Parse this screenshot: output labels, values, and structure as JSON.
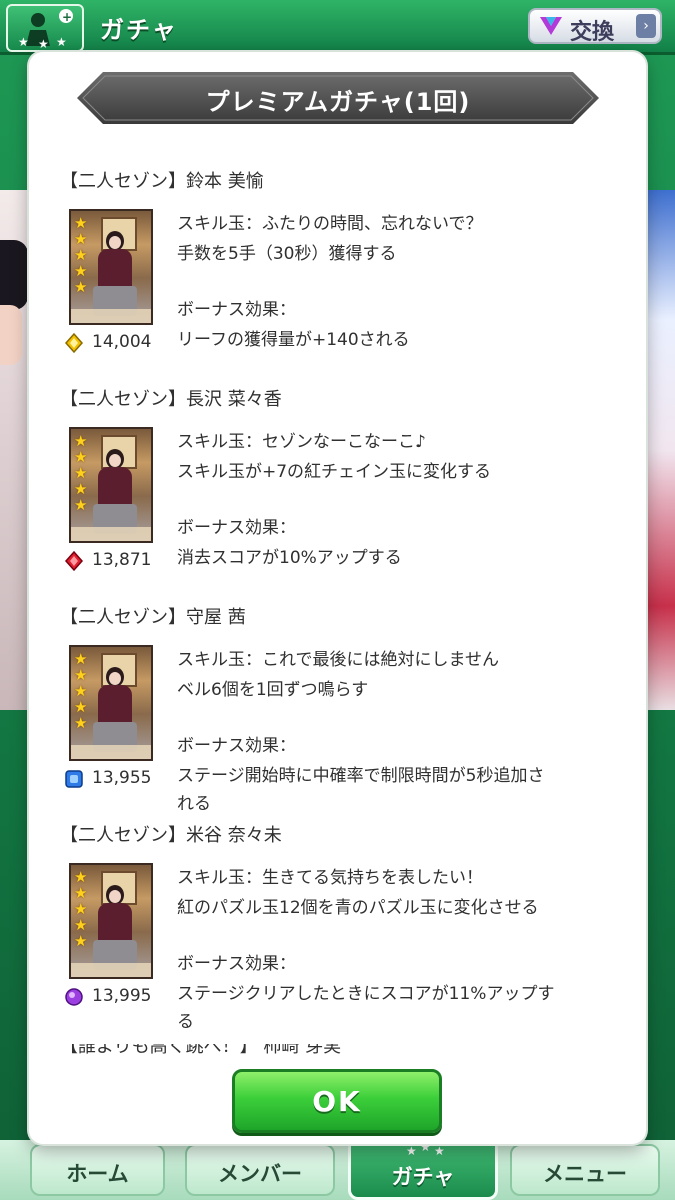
{
  "topbar": {
    "title": "ガチャ",
    "exchange_label": "交換"
  },
  "modal": {
    "title": "プレミアムガチャ(1回)",
    "entries": [
      {
        "name": "【二人セゾン】鈴本 美愉",
        "skill_name": "スキル玉：ふたりの時間、忘れないで？",
        "skill_desc": "手数を5手（30秒）獲得する",
        "bonus_heading": "ボーナス効果：",
        "bonus_lines": [
          "リーフの獲得量が+140される"
        ],
        "points": "14,004",
        "gem_color": "#f2c200"
      },
      {
        "name": "【二人セゾン】長沢 菜々香",
        "skill_name": "スキル玉：セゾンなーこなーこ♪",
        "skill_desc": "スキル玉が+7の紅チェイン玉に変化する",
        "bonus_heading": "ボーナス効果：",
        "bonus_lines": [
          "消去スコアが10%アップする"
        ],
        "points": "13,871",
        "gem_color": "#e0202e"
      },
      {
        "name": "【二人セゾン】守屋 茜",
        "skill_name": "スキル玉：これで最後には絶対にしません",
        "skill_desc": "ベル6個を1回ずつ鳴らす",
        "bonus_heading": "ボーナス効果：",
        "bonus_lines": [
          "ステージ開始時に中確率で制限時間が5秒追加さ",
          "れる"
        ],
        "points": "13,955",
        "gem_color": "#2e7be8"
      },
      {
        "name": "【二人セゾン】米谷 奈々未",
        "skill_name": "スキル玉：生きてる気持ちを表したい！",
        "skill_desc": "紅のパズル玉12個を青のパズル玉に変化させる",
        "bonus_heading": "ボーナス効果：",
        "bonus_lines": [
          "ステージクリアしたときにスコアが11%アップす",
          "る"
        ],
        "points": "13,995",
        "gem_color": "#9b3fe0"
      }
    ],
    "peek_text": "【誰よりも高く跳べ！】 柿崎 芽実",
    "ok_label": "OK"
  },
  "nav": {
    "home": "ホーム",
    "member": "メンバー",
    "gacha": "ガチャ",
    "menu": "メニュー"
  },
  "icons": {
    "emblem": "stars-emblem-icon",
    "exchange": "v-emblem-icon",
    "gem": "gem-icon",
    "star": "rarity-star-icon"
  }
}
